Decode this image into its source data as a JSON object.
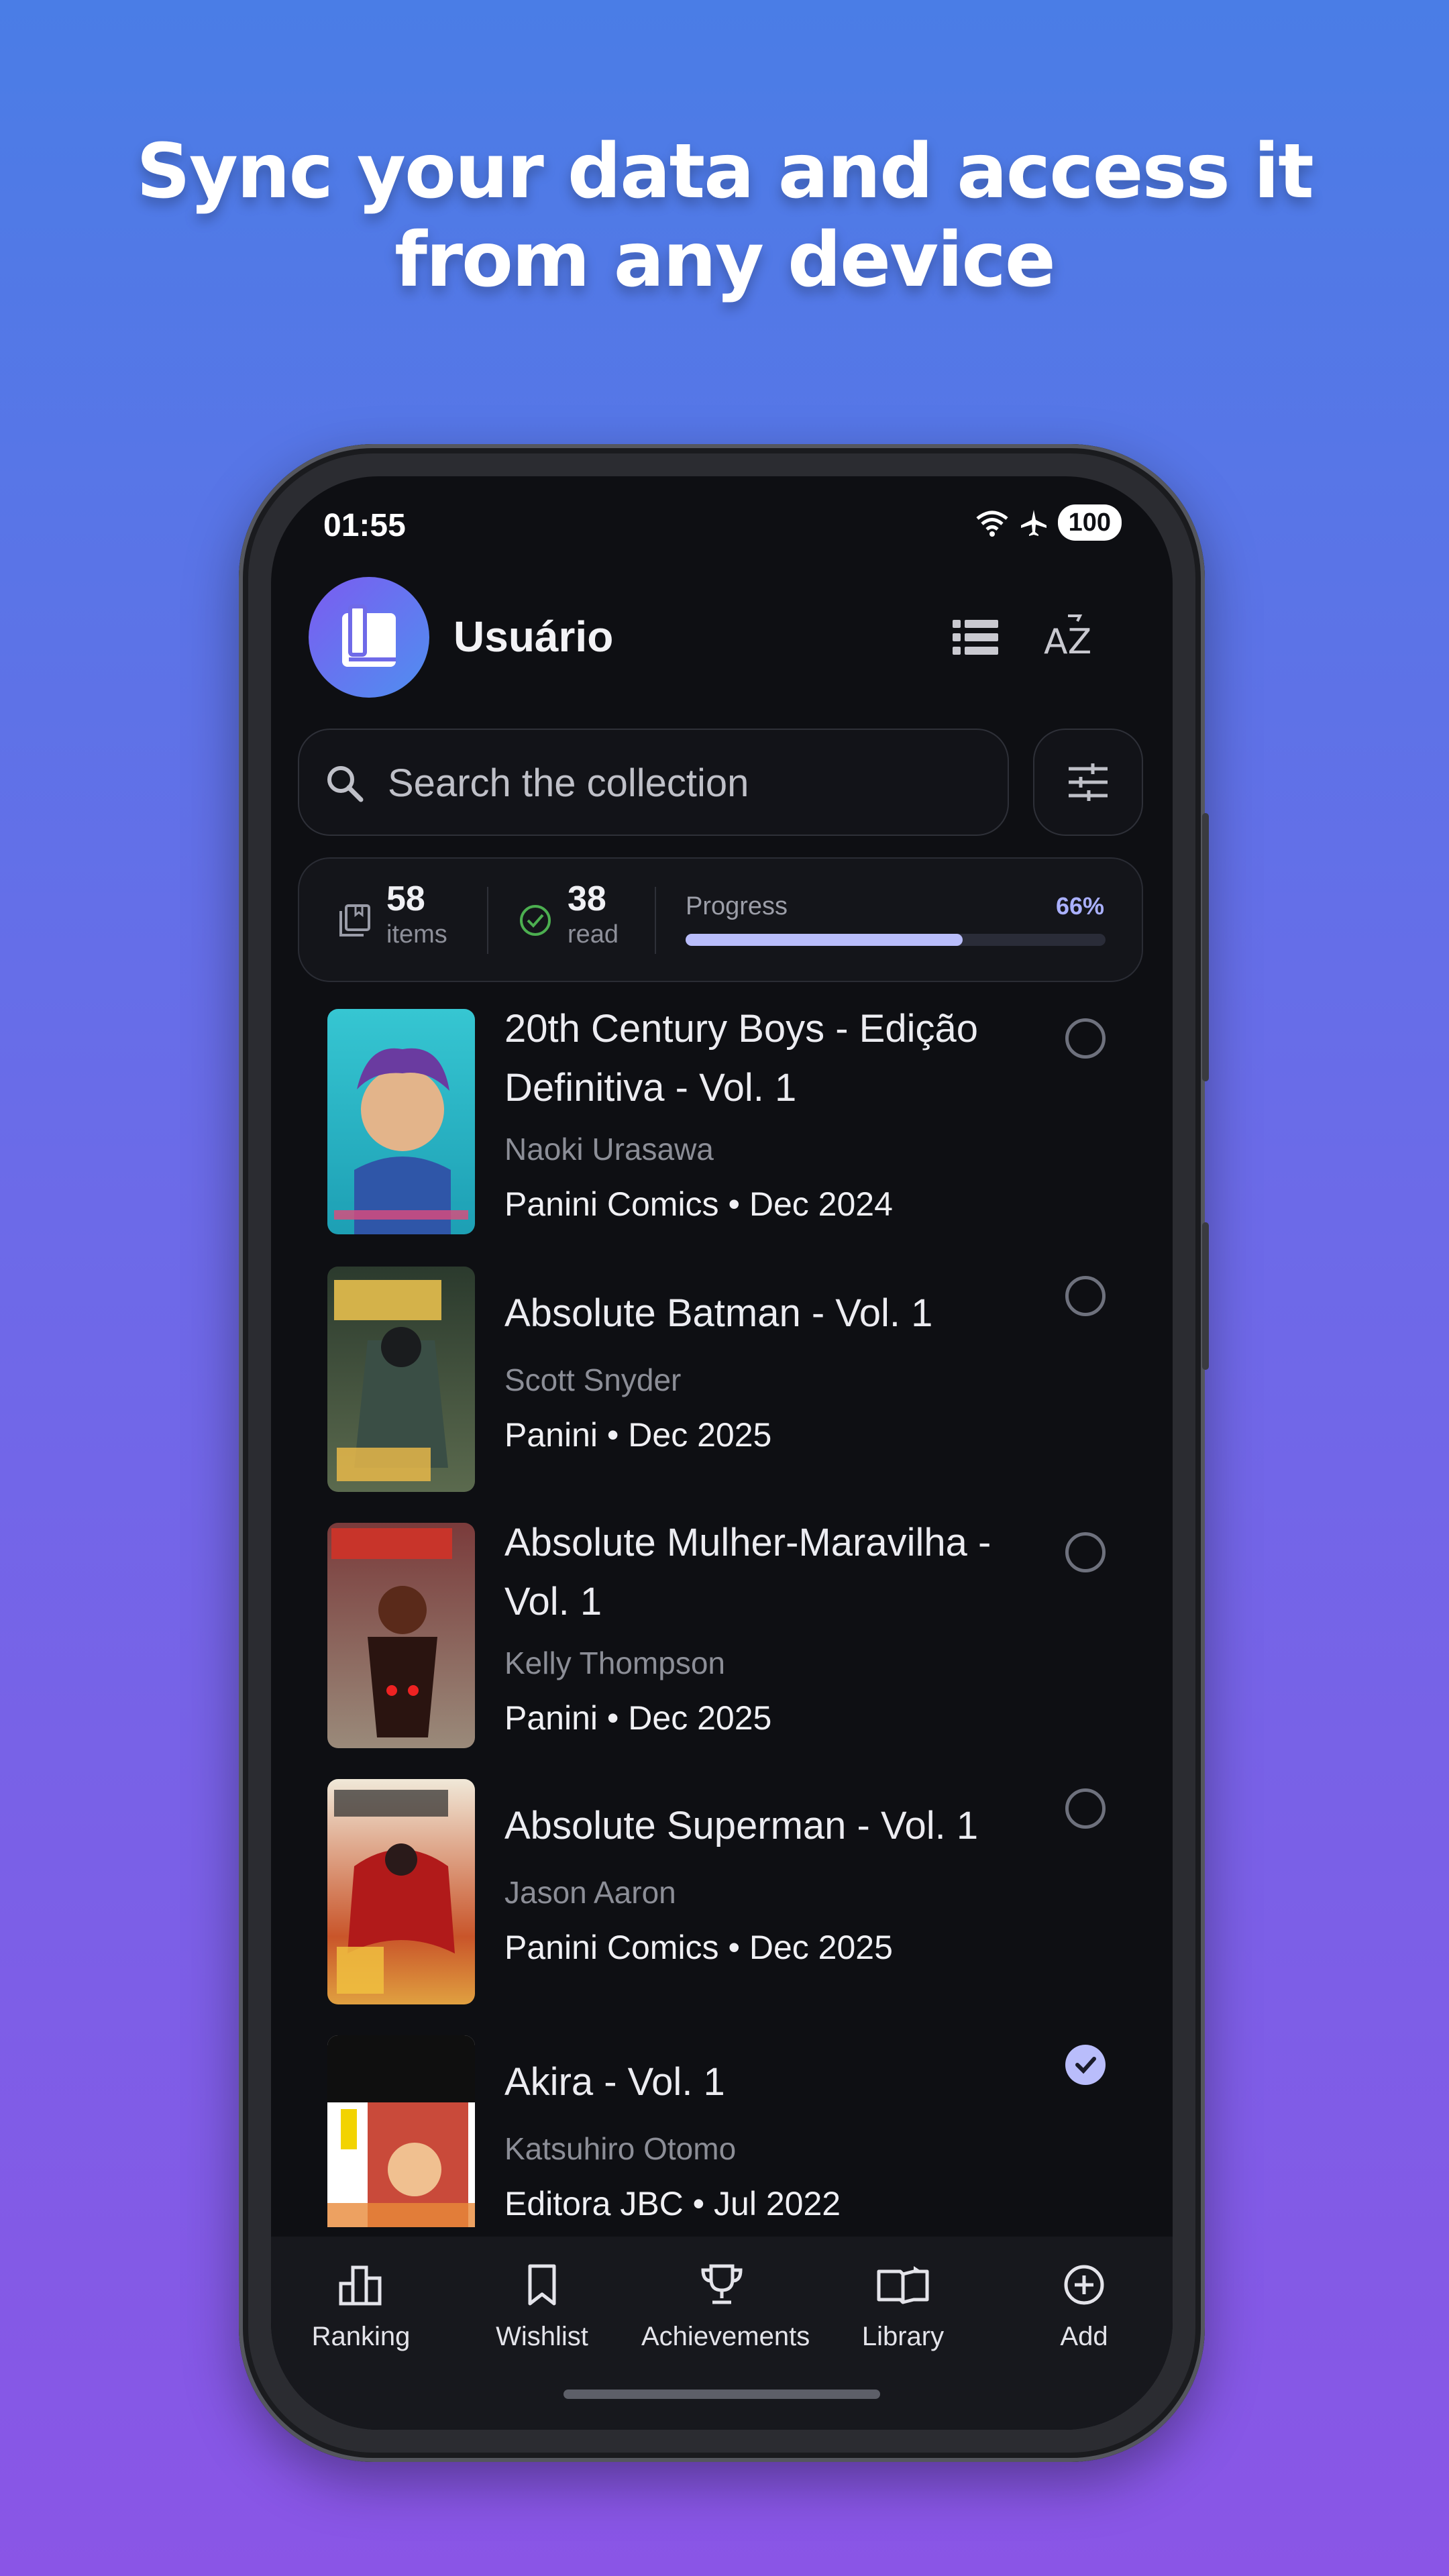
{
  "headline": {
    "line1": "Sync your data and access it",
    "line2": "from any device"
  },
  "status_bar": {
    "time": "01:55",
    "battery": "100",
    "icons": [
      "wifi-icon",
      "airplane-icon"
    ]
  },
  "app_bar": {
    "user_name": "Usuário",
    "actions": [
      "list-view-icon",
      "sort-az-icon"
    ],
    "sort_label": "AZ"
  },
  "search": {
    "placeholder": "Search the collection"
  },
  "stats": {
    "items_count": "58",
    "items_label": "items",
    "read_count": "38",
    "read_label": "read",
    "progress_label": "Progress",
    "progress_percent": "66%",
    "progress_value": 0.66
  },
  "books": [
    {
      "title_line1": "20th Century Boys - Edição",
      "title_line2": "Definitiva - Vol. 1",
      "author": "Naoki Urasawa",
      "publisher_date": "Panini Comics • Dec 2024",
      "read": false,
      "cover_color": "#2bbcc9"
    },
    {
      "title_line1": "Absolute Batman - Vol. 1",
      "author": "Scott Snyder",
      "publisher_date": "Panini • Dec 2025",
      "read": false,
      "cover_color": "#3b4a3a"
    },
    {
      "title_line1": "Absolute Mulher-Maravilha -",
      "title_line2": "Vol. 1",
      "author": "Kelly Thompson",
      "publisher_date": "Panini • Dec 2025",
      "read": false,
      "cover_color": "#8a2a2a"
    },
    {
      "title_line1": "Absolute Superman - Vol. 1",
      "author": "Jason Aaron",
      "publisher_date": "Panini Comics • Dec 2025",
      "read": false,
      "cover_color": "#c9552a"
    },
    {
      "title_line1": "Akira - Vol. 1",
      "author": "Katsuhiro Otomo",
      "publisher_date": "Editora JBC • Jul 2022",
      "read": true,
      "cover_color": "#1a1a1a"
    }
  ],
  "bottom_nav": [
    {
      "label": "Ranking",
      "icon": "bar-chart-icon"
    },
    {
      "label": "Wishlist",
      "icon": "bookmark-icon"
    },
    {
      "label": "Achievements",
      "icon": "trophy-icon"
    },
    {
      "label": "Library",
      "icon": "open-book-icon"
    },
    {
      "label": "Add",
      "icon": "plus-circle-icon"
    }
  ],
  "colors": {
    "accent": "#b9bdfb",
    "background": "#0e0f13",
    "check_ok": "#4caf50"
  }
}
